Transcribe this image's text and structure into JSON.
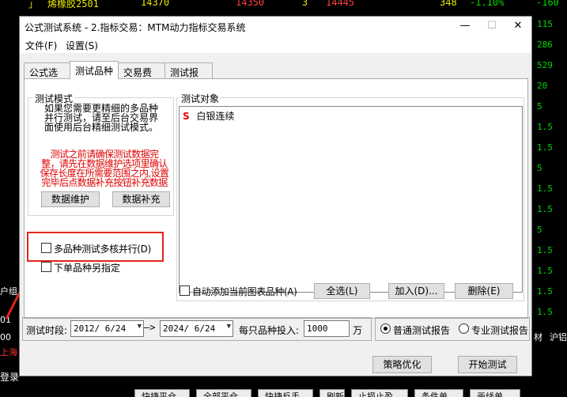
{
  "background": {
    "ticker_name": "烯橡胶2501",
    "ticker_values": [
      "14370",
      "14350",
      "3",
      "14445",
      "348",
      "-1.10%",
      "-160"
    ],
    "right_column": [
      "115",
      "286",
      "529",
      "20",
      "5",
      "1.5",
      "1.5",
      "5",
      "1.5",
      "1.5",
      "5",
      "1.5",
      "1.5",
      "1.5",
      "1.5"
    ],
    "left_labels": [
      "户组",
      "01",
      "00",
      "上海"
    ],
    "bottom_labels": [
      "登录",
      "材",
      "沪铝"
    ],
    "bottom_buttons": [
      "快捷平仓",
      "全部平仓",
      "快捷反手",
      "刷新",
      "止损止盈",
      "条件单",
      "画线单"
    ]
  },
  "dialog": {
    "title": "公式测试系统 - 2.指标交易：MTM动力指标交易系统",
    "menu": [
      "文件(F)",
      "设置(S)"
    ],
    "tabs": [
      "公式选择",
      "测试品种",
      "交易费用",
      "测试报告"
    ],
    "mode_group": {
      "legend": "测试模式",
      "note_lines": [
        "如果您需要更精细的多品种",
        "并行测试，请至后台交易界",
        "面使用后台精细测试模式。"
      ],
      "warning_lines": [
        "测试之前请确保测试数据完",
        "整，请先在数据维护选项里确认",
        "保存长度在所需要范围之内,设置",
        "完毕后点数据补充按钮补充数据"
      ],
      "maintain_button": "数据维护",
      "supplement_button": "数据补充"
    },
    "multi_core_label": "多品种测试多核并行(D)",
    "single_specify_label": "下单品种另指定",
    "target_group": {
      "legend": "测试对象",
      "items": [
        {
          "prefix": "S",
          "name": "白银连续"
        }
      ],
      "auto_add_label": "自动添加当前图表品种(A)",
      "select_all_button": "全选(L)",
      "add_button": "加入(D)...",
      "delete_button": "删除(E)"
    },
    "period_label": "测试时段:",
    "date_from": "2012/ 6/24",
    "date_to": "2024/ 6/24",
    "arrow": "—>",
    "invest_label": "每只品种投入:",
    "invest_value": "1000",
    "invest_unit": "万",
    "report_normal": "普通测试报告",
    "report_pro": "专业测试报告",
    "optimize_button": "策略优化",
    "start_button": "开始测试"
  },
  "colors": {
    "accent_red": "#e3241b",
    "warning_red": "#e00000"
  }
}
